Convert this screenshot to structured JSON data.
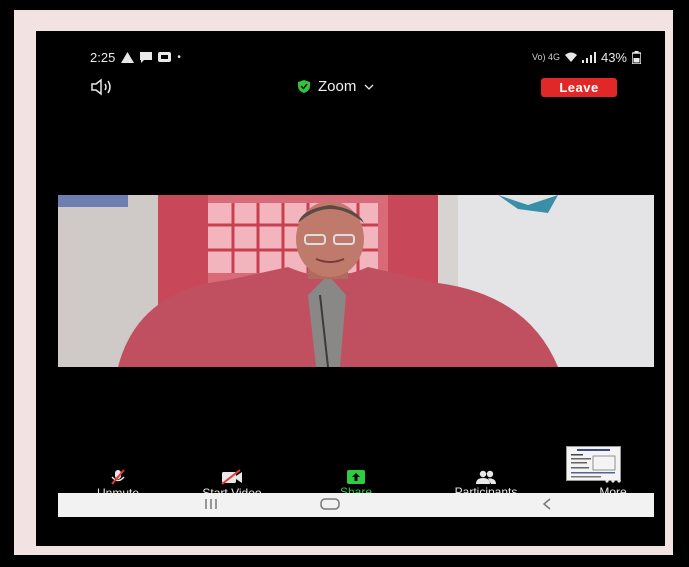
{
  "status_bar": {
    "time": "2:25",
    "network_label": "Vo) 4G",
    "battery": "43%"
  },
  "top_bar": {
    "title": "Zoom",
    "leave_label": "Leave"
  },
  "toolbar": {
    "unmute_label": "Unmute",
    "start_video_label": "Start Video",
    "share_label": "Share",
    "participants_label": "Participants",
    "more_label": "More"
  },
  "colors": {
    "leave": "#e02828",
    "share": "#2ecc40",
    "shield": "#35c13a",
    "frame": "#f3e2e2"
  }
}
